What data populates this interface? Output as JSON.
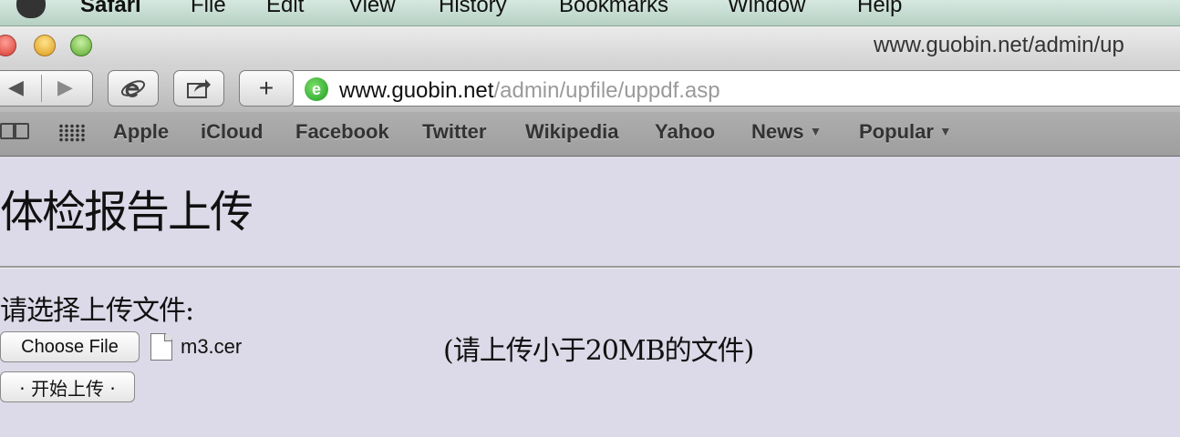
{
  "menubar": {
    "app": "Safari",
    "items": [
      "File",
      "Edit",
      "View",
      "History",
      "Bookmarks",
      "Window",
      "Help"
    ]
  },
  "window": {
    "title": "www.guobin.net/admin/up"
  },
  "toolbar": {
    "plus_label": "+",
    "url_host": "www.guobin.net",
    "url_path": "/admin/upfile/uppdf.asp",
    "favicon_letter": "e"
  },
  "bookmarks": {
    "items": [
      "Apple",
      "iCloud",
      "Facebook",
      "Twitter",
      "Wikipedia",
      "Yahoo",
      "News",
      "Popular"
    ],
    "dropdown_marker": "▼"
  },
  "page": {
    "title": "体检报告上传",
    "prompt": "请选择上传文件:",
    "choose_file_label": "Choose File",
    "selected_file": "m3.cer",
    "size_hint": "(请上传小于20MB的文件)",
    "upload_label": "· 开始上传 ·"
  },
  "icons": [
    "apple-icon",
    "back-arrow-icon",
    "forward-arrow-icon",
    "internet-explorer-icon",
    "share-icon",
    "favicon-icon",
    "reading-list-icon",
    "top-sites-icon",
    "file-icon"
  ]
}
